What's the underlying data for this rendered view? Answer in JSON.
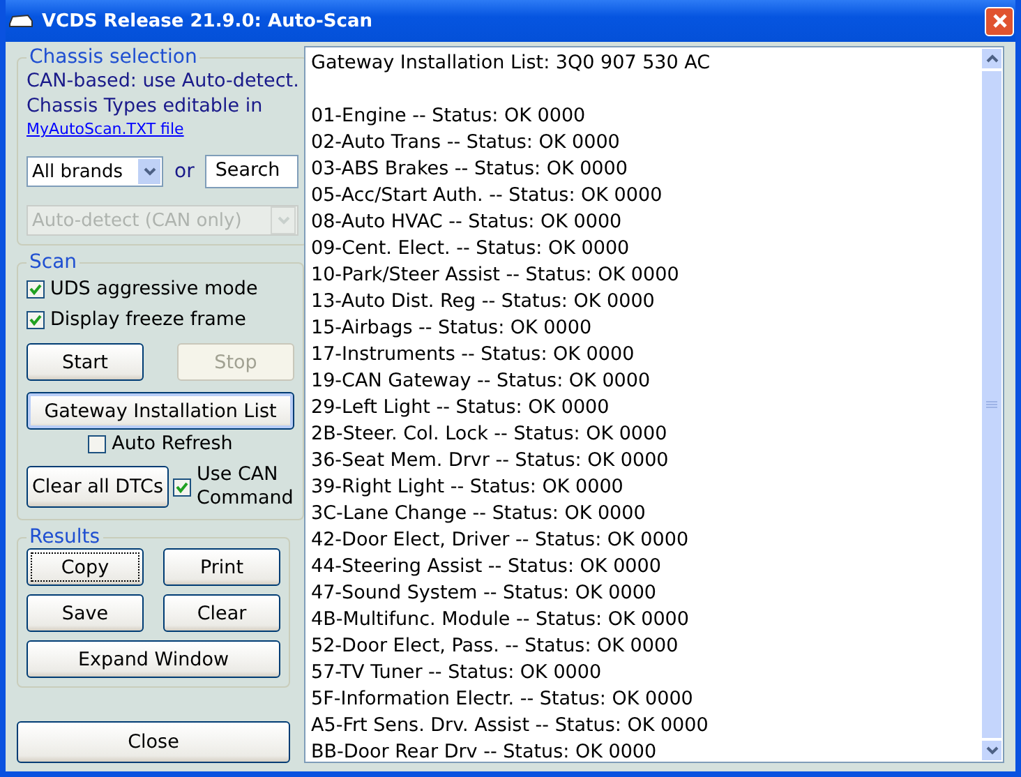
{
  "window": {
    "title": "VCDS Release 21.9.0:  Auto-Scan"
  },
  "chassis": {
    "legend": "Chassis selection",
    "note_lines": [
      "CAN-based: use Auto-detect.",
      "Chassis Types editable in"
    ],
    "link": "MyAutoScan.TXT file",
    "brand": "All brands",
    "or": "or",
    "search": "Search",
    "chassis_type": {
      "value": "Auto-detect (CAN only)",
      "disabled": true
    }
  },
  "scan": {
    "legend": "Scan",
    "options": [
      {
        "label": "UDS aggressive mode",
        "checked": true
      },
      {
        "label": "Display freeze frame",
        "checked": true
      }
    ],
    "start": {
      "label": "Start",
      "disabled": false
    },
    "stop": {
      "label": "Stop",
      "disabled": true
    },
    "gateway": "Gateway Installation List",
    "auto_refresh": {
      "label": "Auto Refresh",
      "checked": false
    },
    "clear_dtcs": "Clear all DTCs",
    "use_can": {
      "label": "Use CAN Command",
      "checked": true
    }
  },
  "results": {
    "legend": "Results",
    "buttons": [
      "Copy",
      "Print",
      "Save",
      "Clear"
    ],
    "expand": "Expand Window"
  },
  "close": "Close",
  "output_header": "Gateway Installation List:  3Q0 907 530 AC",
  "output": [
    "01-Engine -- Status: OK 0000",
    "02-Auto Trans -- Status: OK 0000",
    "03-ABS Brakes -- Status: OK 0000",
    "05-Acc/Start Auth. -- Status: OK 0000",
    "08-Auto HVAC -- Status: OK 0000",
    "09-Cent. Elect. -- Status: OK 0000",
    "10-Park/Steer Assist -- Status: OK 0000",
    "13-Auto Dist. Reg -- Status: OK 0000",
    "15-Airbags -- Status: OK 0000",
    "17-Instruments -- Status: OK 0000",
    "19-CAN Gateway -- Status: OK 0000",
    "29-Left Light -- Status: OK 0000",
    "2B-Steer. Col. Lock -- Status: OK 0000",
    "36-Seat Mem. Drvr -- Status: OK 0000",
    "39-Right Light -- Status: OK 0000",
    "3C-Lane Change -- Status: OK 0000",
    "42-Door Elect, Driver -- Status: OK 0000",
    "44-Steering Assist -- Status: OK 0000",
    "47-Sound System -- Status: OK 0000",
    "4B-Multifunc. Module -- Status: OK 0000",
    "52-Door Elect, Pass. -- Status: OK 0000",
    "57-TV Tuner -- Status: OK 0000",
    "5F-Information Electr. -- Status: OK 0000",
    "A5-Frt Sens. Drv. Assist -- Status: OK 0000",
    "BB-Door Rear Drv -- Status: OK 0000"
  ]
}
